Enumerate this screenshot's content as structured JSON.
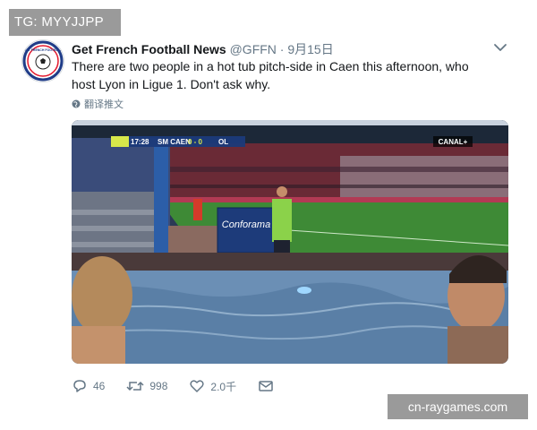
{
  "watermarks": {
    "top_left": "TG: MYYJJPP",
    "bottom_right": "cn-raygames.com"
  },
  "tweet": {
    "author_name": "Get French Football News",
    "handle_date": "@GFFN · 9月15日",
    "text": "There are two people in a hot tub pitch-side in Caen this afternoon, who host Lyon in Ligue 1. Don't ask why.",
    "translate_label": "翻译推文",
    "avatar_logo_text": "GET FRENCH FOOTBALL"
  },
  "media": {
    "scoreboard": {
      "time": "17:28",
      "home": "SM CAEN",
      "score": "0 - 0",
      "away": "OL"
    },
    "broadcaster": "CANAL+",
    "ad_board": "Conforama"
  },
  "actions": {
    "replies": "46",
    "retweets": "998",
    "likes": "2.0千"
  }
}
